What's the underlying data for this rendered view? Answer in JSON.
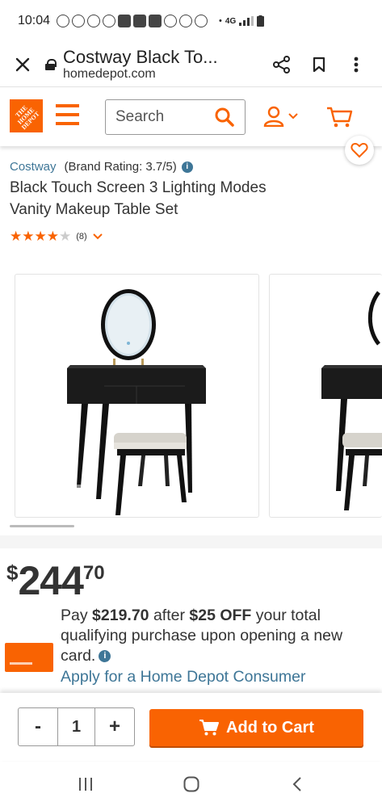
{
  "status_bar": {
    "time": "10:04",
    "network": "4G"
  },
  "browser": {
    "close_icon": "close-icon",
    "title": "Costway Black To...",
    "domain": "homedepot.com",
    "share_icon": "share-icon",
    "bookmark_icon": "bookmark-icon",
    "menu_icon": "more-vert-icon"
  },
  "header": {
    "logo_text": "THE HOME DEPOT",
    "search_placeholder": "Search",
    "accent_color": "#f96302"
  },
  "product": {
    "brand": "Costway",
    "brand_rating": "(Brand Rating: 3.7/5)",
    "title": "Black Touch Screen 3 Lighting Modes Vanity Makeup Table Set",
    "rating_stars": 4,
    "rating_max": 5,
    "review_count": "(8)"
  },
  "price": {
    "currency": "$",
    "dollars": "244",
    "cents": "70"
  },
  "promo": {
    "text_1": "Pay ",
    "promo_price": "$219.70",
    "text_2": " after ",
    "discount": "$25 OFF",
    "text_3": " your total qualifying purchase upon opening a new card.",
    "apply_link": "Apply for a Home Depot Consumer"
  },
  "cart": {
    "minus": "-",
    "quantity": "1",
    "plus": "+",
    "add_label": "Add to Cart"
  }
}
